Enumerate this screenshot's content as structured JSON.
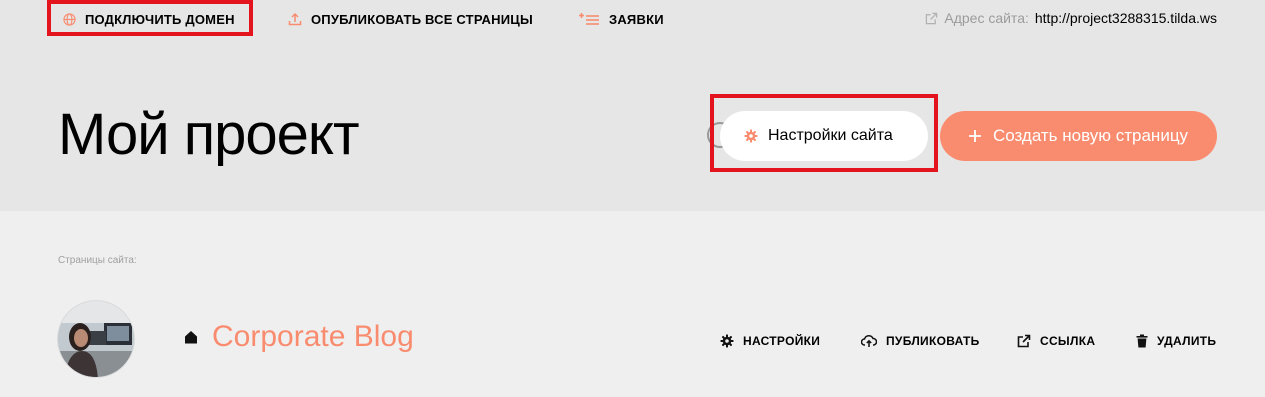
{
  "toolbar": {
    "connect_domain_label": "ПОДКЛЮЧИТЬ ДОМЕН",
    "publish_all_label": "ОПУБЛИКОВАТЬ ВСЕ СТРАНИЦЫ",
    "requests_label": "ЗАЯВКИ",
    "site_address_label": "Адрес сайта:",
    "site_address_url": "http://project3288315.tilda.ws"
  },
  "header": {
    "project_title": "Мой проект",
    "settings_label": "Настройки сайта",
    "create_page_label": "Создать новую страницу"
  },
  "pages": {
    "section_label": "Страницы сайта:",
    "items": [
      {
        "title": "Corporate Blog",
        "actions": {
          "settings": "НАСТРОЙКИ",
          "publish": "ПУБЛИКОВАТЬ",
          "link": "ССЫЛКА",
          "delete": "УДАЛИТЬ"
        }
      }
    ]
  },
  "colors": {
    "accent": "#f98c6f",
    "highlight": "#e3141e",
    "header_bg": "#e6e6e6",
    "body_bg": "#efefef"
  },
  "icons": {
    "connect_domain": "globe-icon",
    "publish_all": "upload-icon",
    "requests": "list-add-icon",
    "external": "external-link-icon",
    "settings": "gear-icon",
    "create": "plus-icon",
    "home": "home-icon",
    "publish": "cloud-upload-icon",
    "delete": "trash-icon"
  }
}
